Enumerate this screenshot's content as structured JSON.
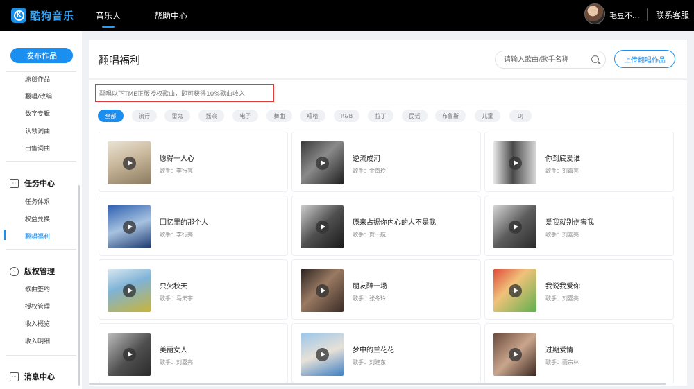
{
  "app": {
    "logo_text": "酷狗音乐",
    "logo_mark": "K"
  },
  "topnav": [
    {
      "label": "音乐人",
      "active": true
    },
    {
      "label": "帮助中心",
      "active": false
    }
  ],
  "user": {
    "name": "毛豆不...",
    "service_label": "联系客服"
  },
  "sidebar": {
    "publish_label": "发布作品",
    "works_items": [
      "原创作品",
      "翻唱/改编",
      "数字专辑",
      "认领词曲",
      "出售词曲"
    ],
    "task_title": "任务中心",
    "task_items": [
      "任务体系",
      "权益兑换",
      "翻唱福利"
    ],
    "active_item": "翻唱福利",
    "copyright_title": "版权管理",
    "copyright_items": [
      "歌曲签约",
      "授权管理",
      "收入概览",
      "收入明细"
    ],
    "message_title": "消息中心"
  },
  "header": {
    "title": "翻唱福利",
    "search_placeholder": "请输入歌曲/歌手名称",
    "upload_label": "上传翻唱作品"
  },
  "notice": "翻唱以下TME正版授权歌曲，即可获得10%歌曲收入",
  "genres": {
    "items": [
      "全部",
      "流行",
      "雷鬼",
      "摇滚",
      "电子",
      "舞曲",
      "嘻哈",
      "R&B",
      "拉丁",
      "民谣",
      "布鲁斯",
      "儿童",
      "DJ"
    ],
    "active": "全部"
  },
  "songs": [
    {
      "title": "愿得一人心",
      "singer": "歌手：李行亮"
    },
    {
      "title": "逆流成河",
      "singer": "歌手：金南玲"
    },
    {
      "title": "你到底爱谁",
      "singer": "歌手：刘嘉亮"
    },
    {
      "title": "回忆里的那个人",
      "singer": "歌手：李行亮"
    },
    {
      "title": "原来占据你内心的人不是我",
      "singer": "歌手：贺一航"
    },
    {
      "title": "爱我就别伤害我",
      "singer": "歌手：刘嘉亮"
    },
    {
      "title": "只欠秋天",
      "singer": "歌手：马天宇"
    },
    {
      "title": "朋友醉一场",
      "singer": "歌手：张冬玲"
    },
    {
      "title": "我说我爱你",
      "singer": "歌手：刘嘉亮"
    },
    {
      "title": "美丽女人",
      "singer": "歌手：刘嘉亮"
    },
    {
      "title": "梦中的兰花花",
      "singer": "歌手：刘建东"
    },
    {
      "title": "过期爱情",
      "singer": "歌手：雨宗林"
    }
  ],
  "colors": {
    "accent": "#1b8ff0",
    "notice_border": "#e53935",
    "topbar": "#000000"
  }
}
